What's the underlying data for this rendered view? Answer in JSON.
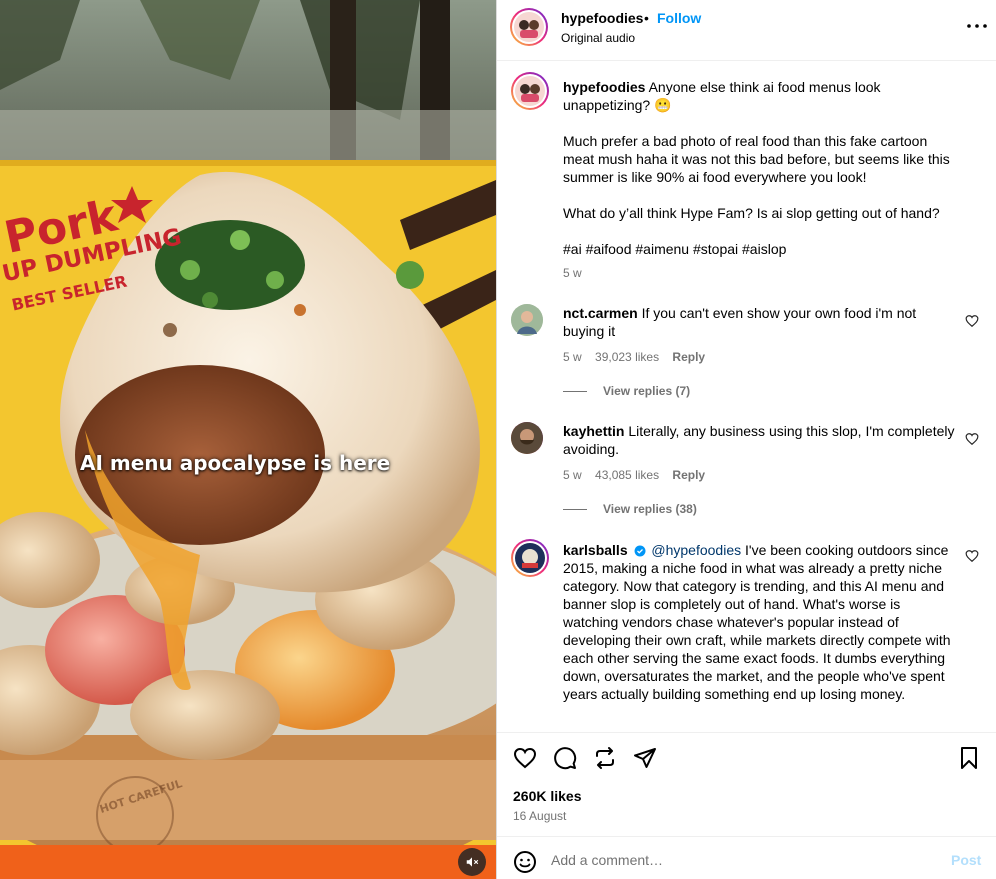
{
  "media": {
    "overlay_text": "AI menu apocalypse is here",
    "banner_line1": "Pork",
    "banner_line2": "UP DUMPLING",
    "banner_line3": "BEST SELLER",
    "steamer_stamp": "HOT CAREFUL",
    "mute_icon": "muted-speaker-icon",
    "colors": {
      "banner": "#f3c62f",
      "banner_text": "#c8242d",
      "dumpling": "#f1e4cf",
      "steamer": "#d39a5e"
    }
  },
  "header": {
    "username": "hypefoodies",
    "separator": "•",
    "follow_label": "Follow",
    "subtitle": "Original audio",
    "more_icon": "more-horizontal-icon"
  },
  "caption": {
    "username": "hypefoodies",
    "para1": "Anyone else think ai food menus look unappetizing? 😬",
    "para2": "Much prefer a bad photo of real food than this fake cartoon meat mush haha it was not this bad before, but seems like this summer is like 90% ai food everywhere you look!",
    "para3": "What do y’all think Hype Fam? Is ai slop getting out of hand?",
    "hashtags": "#ai #aifood #aimenu #stopai #aislop",
    "time": "5 w"
  },
  "comments": [
    {
      "username": "nct.carmen",
      "text": "If you can't even show your own food i'm not buying it",
      "time": "5 w",
      "likes": "39,023 likes",
      "reply_label": "Reply",
      "view_replies": "View replies (7)"
    },
    {
      "username": "kayhettin",
      "text": "Literally, any business using this slop, I'm completely avoiding.",
      "time": "5 w",
      "likes": "43,085 likes",
      "reply_label": "Reply",
      "view_replies": "View replies (38)"
    },
    {
      "username": "karlsballs",
      "mention": "@hypefoodies",
      "text": "I've been cooking outdoors since 2015, making a niche food in what was already a pretty niche category. Now that category is trending, and this AI menu and banner slop is completely out of hand. What's worse is watching vendors chase whatever's popular instead of developing their own craft, while markets directly compete with each other serving the same exact foods. It dumbs everything down, oversaturates the market, and the people who've spent years actually building something end up losing money."
    }
  ],
  "actions": {
    "like_icon": "heart-icon",
    "comment_icon": "comment-icon",
    "share_icon": "repost-icon",
    "send_icon": "send-icon",
    "save_icon": "bookmark-icon",
    "likes_count": "260K likes",
    "date": "16 August"
  },
  "compose": {
    "emoji_icon": "emoji-icon",
    "placeholder": "Add a comment…",
    "post_label": "Post"
  },
  "accent": "#0095f6"
}
